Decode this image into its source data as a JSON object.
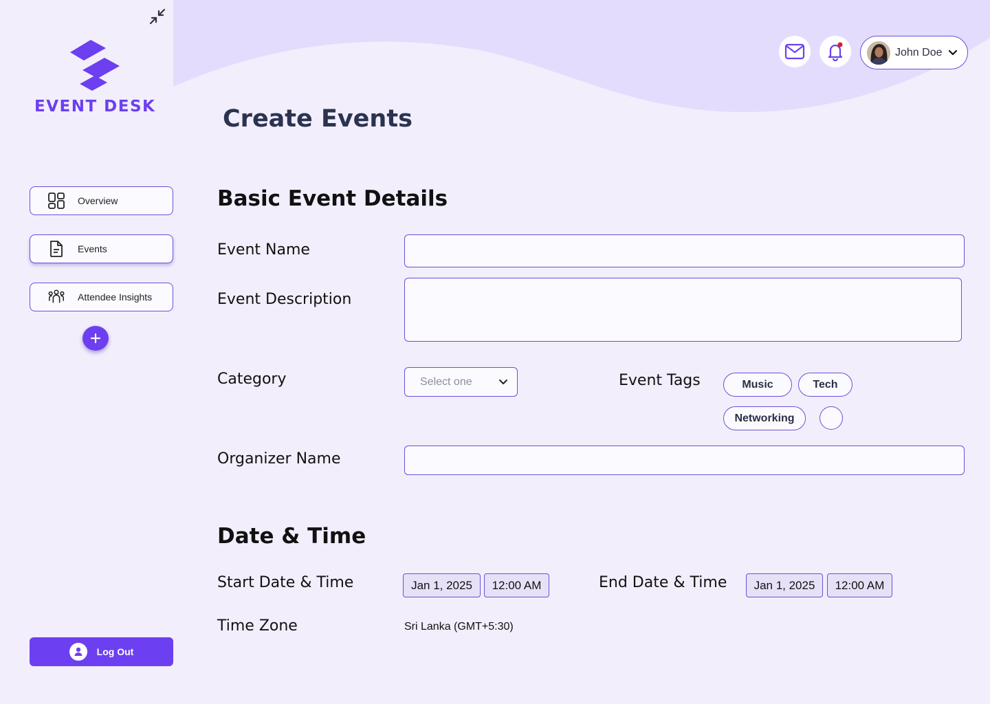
{
  "brand": {
    "name": "EVENT DESK",
    "accent": "#6c3ff0"
  },
  "sidebar": {
    "items": [
      {
        "label": "Overview",
        "icon": "dashboard-icon"
      },
      {
        "label": "Events",
        "icon": "document-icon"
      },
      {
        "label": "Attendee Insights",
        "icon": "people-icon"
      }
    ],
    "logout_label": "Log Out"
  },
  "header": {
    "user_name": "John Doe"
  },
  "page": {
    "title": "Create Events"
  },
  "basic": {
    "title": "Basic Event Details",
    "event_name_label": "Event Name",
    "event_name_value": "",
    "event_description_label": "Event Description",
    "event_description_value": "",
    "category_label": "Category",
    "category_placeholder": "Select one",
    "tags_label": "Event Tags",
    "tags": [
      "Music",
      "Tech",
      "Networking"
    ],
    "organizer_label": "Organizer Name",
    "organizer_value": ""
  },
  "datetime": {
    "title": "Date & Time",
    "start_label": "Start Date & Time",
    "start_date": "Jan 1, 2025",
    "start_time": "12:00 AM",
    "end_label": "End Date & Time",
    "end_date": "Jan 1, 2025",
    "end_time": "12:00 AM",
    "timezone_label": "Time Zone",
    "timezone_value": "Sri Lanka (GMT+5:30)"
  }
}
